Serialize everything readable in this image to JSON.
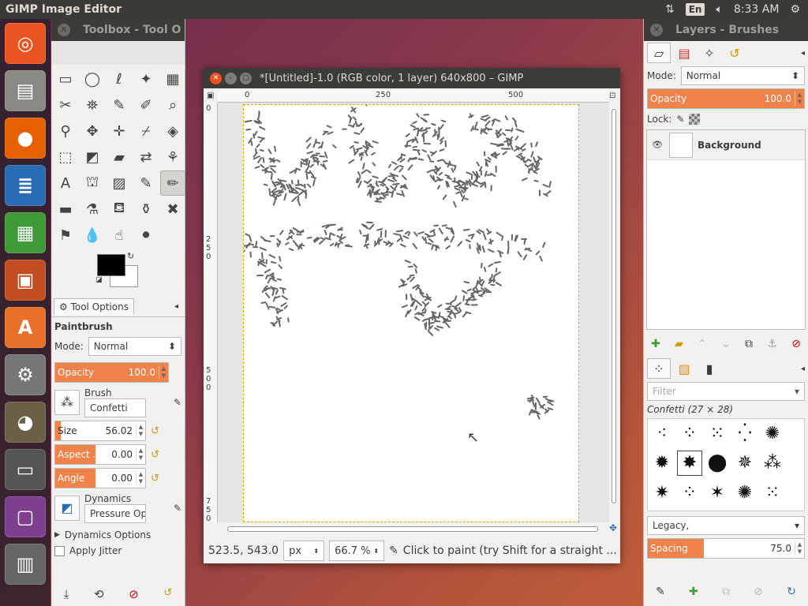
{
  "top_panel": {
    "app_title": "GIMP Image Editor",
    "keyboard_layout": "En",
    "clock": "8:33 AM"
  },
  "launcher": {
    "apps": [
      {
        "name": "ubuntu",
        "glyph": "◎",
        "color": "#e95420"
      },
      {
        "name": "files",
        "glyph": "▤",
        "color": "#8a8a85"
      },
      {
        "name": "firefox",
        "glyph": "●",
        "color": "#e66000"
      },
      {
        "name": "writer",
        "glyph": "≣",
        "color": "#2a6db5"
      },
      {
        "name": "calc",
        "glyph": "▦",
        "color": "#3e9b38"
      },
      {
        "name": "impress",
        "glyph": "▣",
        "color": "#c24d1f"
      },
      {
        "name": "software",
        "glyph": "A",
        "color": "#e8702a"
      },
      {
        "name": "settings",
        "glyph": "⚙",
        "color": "#777"
      },
      {
        "name": "gimp",
        "glyph": "◕",
        "color": "#6b6045"
      },
      {
        "name": "save",
        "glyph": "▭",
        "color": "#555"
      },
      {
        "name": "workspace",
        "glyph": "▢",
        "color": "#7e3f8f"
      },
      {
        "name": "trash",
        "glyph": "▥",
        "color": "#666"
      }
    ]
  },
  "toolbox": {
    "title": "Toolbox - Tool O",
    "tools": [
      "▭",
      "◯",
      "ℓ",
      "✦",
      "▦",
      "✂",
      "⛯",
      "✎",
      "✐",
      "⌕",
      "⚲",
      "✥",
      "✛",
      "⌿",
      "◈",
      "⬚",
      "◩",
      "▰",
      "⇄",
      "⚘",
      "A",
      "⛫",
      "▨",
      "✎",
      "✏",
      "▬",
      "⚗",
      "⛾",
      "⚱",
      "✖",
      "⚑",
      "💧",
      "☝",
      "⚫"
    ],
    "active_tool_index": 24,
    "tab_label": "Tool Options",
    "section": "Paintbrush",
    "mode_label": "Mode:",
    "mode_value": "Normal",
    "opacity_label": "Opacity",
    "opacity_value": "100.0",
    "brush_label": "Brush",
    "brush_value": "Confetti",
    "size_label": "Size",
    "size_value": "56.02",
    "aspect_label": "Aspect ...",
    "aspect_value": "0.00",
    "angle_label": "Angle",
    "angle_value": "0.00",
    "dynamics_label": "Dynamics",
    "dynamics_value": "Pressure Opa",
    "dynamics_options": "Dynamics Options",
    "apply_jitter": "Apply Jitter"
  },
  "image_window": {
    "title": "*[Untitled]-1.0 (RGB color, 1 layer) 640x800 – GIMP",
    "ruler_h": [
      "0",
      "250",
      "500"
    ],
    "ruler_v": [
      "0",
      "250",
      "500",
      "750"
    ],
    "coords": "523.5, 543.0",
    "unit": "px",
    "zoom": "66.7 %",
    "status_message": "Click to paint (try Shift for a straight ..."
  },
  "layers_dock": {
    "title": "Layers - Brushes",
    "mode_label": "Mode:",
    "mode_value": "Normal",
    "opacity_label": "Opacity",
    "opacity_value": "100.0",
    "lock_label": "Lock:",
    "layer_name": "Background",
    "brush_filter_placeholder": "Filter",
    "brush_name": "Confetti (27 × 28)",
    "brush_set": "Legacy,",
    "spacing_label": "Spacing",
    "spacing_value": "75.0"
  },
  "colors": {
    "accent": "#f0824a",
    "panel": "#3c3b37"
  }
}
